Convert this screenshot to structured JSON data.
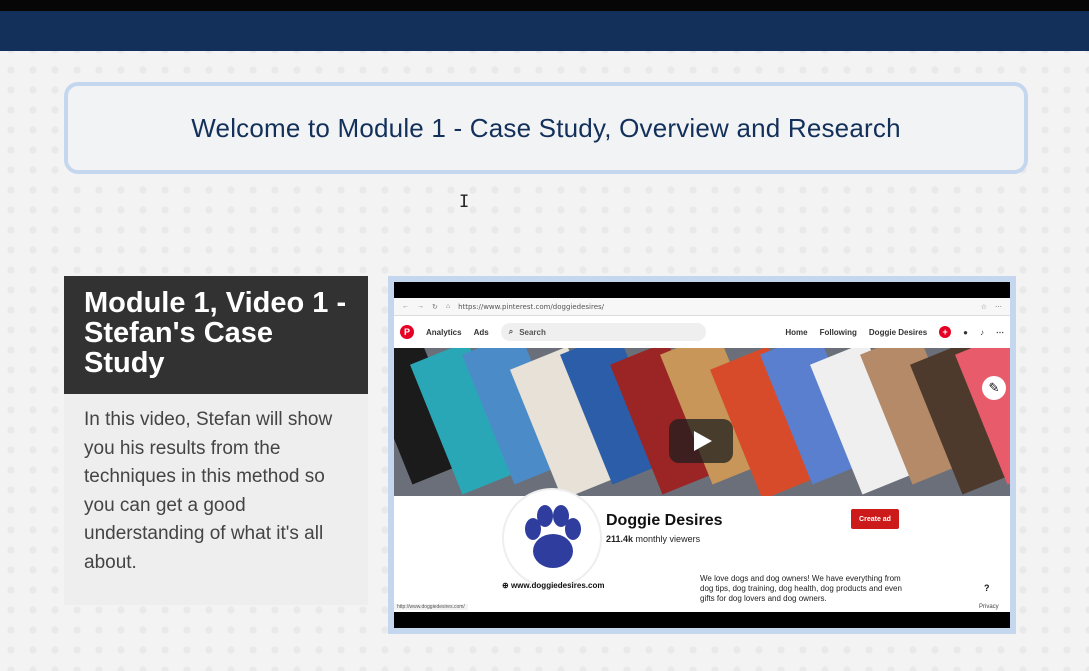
{
  "banner": {
    "title": "Welcome to Module 1 - Case Study, Overview and Research"
  },
  "card": {
    "title": "Module 1, Video 1 - Stefan's Case Study",
    "description": "In this video, Stefan will show you his results from the techniques in this method so you can get a good understanding of what it's all about."
  },
  "video": {
    "browser": {
      "url": "https://www.pinterest.com/doggiedesires/"
    },
    "pinterest": {
      "nav": {
        "analytics": "Analytics",
        "ads": "Ads",
        "search_placeholder": "Search",
        "home": "Home",
        "following": "Following",
        "account": "Doggie Desires"
      },
      "profile": {
        "name": "Doggie Desires",
        "views_count": "211.4k",
        "views_label": "monthly viewers",
        "create_ad": "Create ad",
        "site": "www.doggiedesires.com",
        "about": "We love dogs and dog owners! We have everything from dog tips, dog training, dog health, dog products and even gifts for dog lovers and dog owners.",
        "help": "?",
        "privacy": "Privacy"
      },
      "status_url": "http://www.doggiedesires.com/"
    }
  },
  "colors": {
    "navy": "#13305a",
    "banner_border": "#c5d6ef",
    "card_header": "#323232",
    "pinterest_red": "#e60023",
    "paw_blue": "#2f3e9e"
  },
  "icons": [
    "pinterest-logo-icon",
    "search-icon",
    "plus-icon",
    "chat-icon",
    "bell-icon",
    "more-icon",
    "edit-icon",
    "play-icon",
    "paw-icon",
    "link-icon",
    "text-cursor-icon"
  ]
}
